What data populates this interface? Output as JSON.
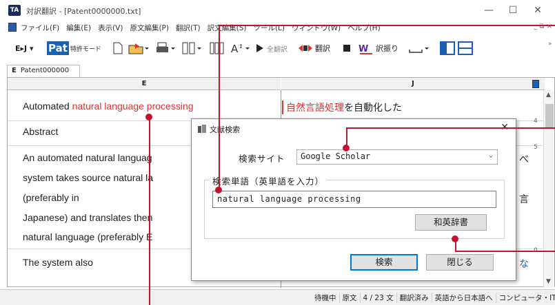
{
  "window": {
    "title": "対訳翻訳 - [Patent0000000.txt]",
    "app_icon_text": "TA",
    "minimize": "—",
    "maximize": "☐",
    "close": "✕"
  },
  "menu": {
    "items": [
      "ファイル(F)",
      "編集(E)",
      "表示(V)",
      "原文編集(P)",
      "翻訳(T)",
      "訳文編集(S)",
      "ツール(L)",
      "ウィンドウ(W)",
      "ヘルプ(H)"
    ],
    "mdi_controls": "_ ⧉ ×"
  },
  "toolbar": {
    "direction": "E▸J ▾",
    "pat_logo": "Pat",
    "mode_label": "特許モード",
    "translate_all": "全翻訳",
    "translate": "翻訳",
    "assign": "訳振り",
    "expand": "»"
  },
  "document": {
    "tab_letter": "E",
    "tab_name": "Patent000000",
    "col_source": "E",
    "col_target": "J",
    "ruler_marks": [
      "4",
      "5",
      "0"
    ],
    "rows": [
      {
        "src_pre": "Automated ",
        "src_hl": "natural language processing",
        "tgt_hl": "自然言語処理",
        "tgt_rest": "を自動化した"
      },
      {
        "src": "Abstract"
      },
      {
        "src": "An automated natural languag"
      },
      {
        "src": "system takes source natural la"
      },
      {
        "src": "(preferably in"
      },
      {
        "src": "Japanese) and translates then"
      },
      {
        "src": "natural language (preferably E"
      },
      {
        "src": "The system also"
      }
    ],
    "tgt_fragments": [
      "べ",
      "言",
      "な"
    ]
  },
  "dialog": {
    "title": "文献検索",
    "site_label": "検索サイト",
    "site_value": "Google Scholar",
    "term_group_label": "検索単語（英単語を入力）",
    "term_value": "natural language processing",
    "dict_button": "和英辞書",
    "search_button": "検索",
    "close_button": "閉じる"
  },
  "status": {
    "items": [
      "待機中",
      "原文",
      "4 / 23 文",
      "翻訳済み",
      "英語から日本語へ",
      "コンピュータ・IT"
    ]
  },
  "colors": {
    "highlight": "#e0322e",
    "callout": "#c4132d",
    "accent": "#0078d7"
  }
}
